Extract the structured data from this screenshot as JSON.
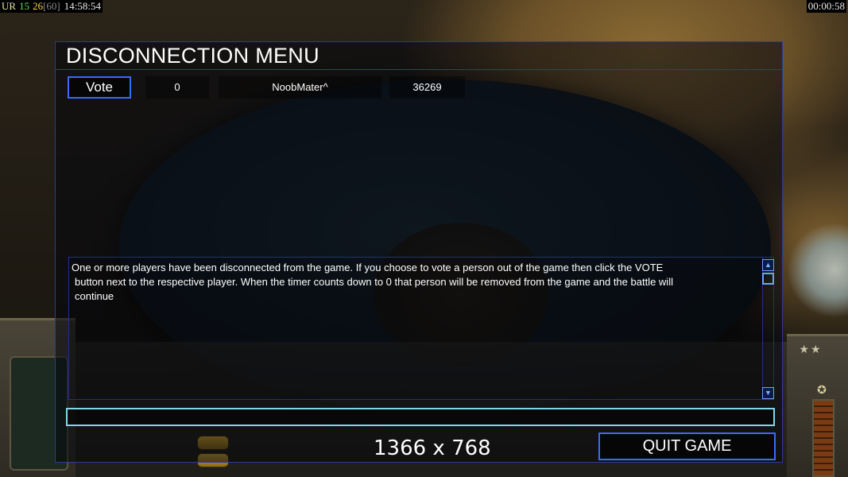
{
  "status_bar": {
    "ur_label": "UR",
    "fps_value": "15",
    "logic_value": "26",
    "logic_cap": "[60]",
    "clock": "14:58:54",
    "game_timer": "00:00:58"
  },
  "dialog": {
    "title": "DISCONNECTION MENU",
    "players": [
      {
        "vote_label": "Vote",
        "votes": "0",
        "name": "NoobMater^",
        "ping": "36269"
      }
    ],
    "message_line1": "One or more players have been disconnected from the game. If you choose to vote a person out of the game then click the VOTE",
    "message_line2": "button next to the respective player. When the timer counts down to 0 that person will be removed from the game and the battle will",
    "message_line3": "continue",
    "chat_value": "",
    "quit_label": "QUIT GAME"
  },
  "overlay": {
    "resolution": "1366 x 768"
  },
  "theme": {
    "border_blue": "#3a6aff",
    "chat_cyan": "#7fd8e8"
  }
}
